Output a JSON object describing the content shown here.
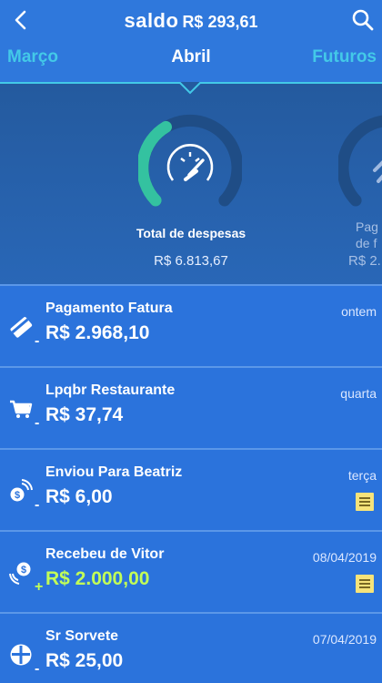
{
  "header": {
    "title": "saldo",
    "balance": "R$ 293,61"
  },
  "tabs": {
    "prev": "Março",
    "active": "Abril",
    "next": "Futuros"
  },
  "summary": {
    "label": "Total de despesas",
    "value": "R$ 6.813,67",
    "side_label_1": "Pag",
    "side_label_2": "de f",
    "side_value": "R$ 2."
  },
  "transactions": [
    {
      "name": "Pagamento Fatura",
      "sign": "-",
      "amount": "R$ 2.968,10",
      "date": "ontem",
      "icon": "card-icon",
      "has_receipt": false
    },
    {
      "name": "Lpqbr Restaurante",
      "sign": "-",
      "amount": "R$ 37,74",
      "date": "quarta",
      "icon": "cart-icon",
      "has_receipt": false
    },
    {
      "name": "Enviou Para Beatriz",
      "sign": "-",
      "amount": "R$ 6,00",
      "date": "terça",
      "icon": "money-send-icon",
      "has_receipt": true
    },
    {
      "name": "Recebeu de Vitor",
      "sign": "+",
      "amount": "R$ 2.000,00",
      "date": "08/04/2019",
      "icon": "money-receive-icon",
      "has_receipt": true
    },
    {
      "name": "Sr Sorvete",
      "sign": "-",
      "amount": "R$ 25,00",
      "date": "07/04/2019",
      "icon": "restaurant-icon",
      "has_receipt": false
    }
  ],
  "colors": {
    "positive": "#c2ff57",
    "gauge_green": "#34c2a0",
    "gauge_track": "#1f4d86",
    "accent": "#43c9e8",
    "receipt": "#f6e37a"
  }
}
